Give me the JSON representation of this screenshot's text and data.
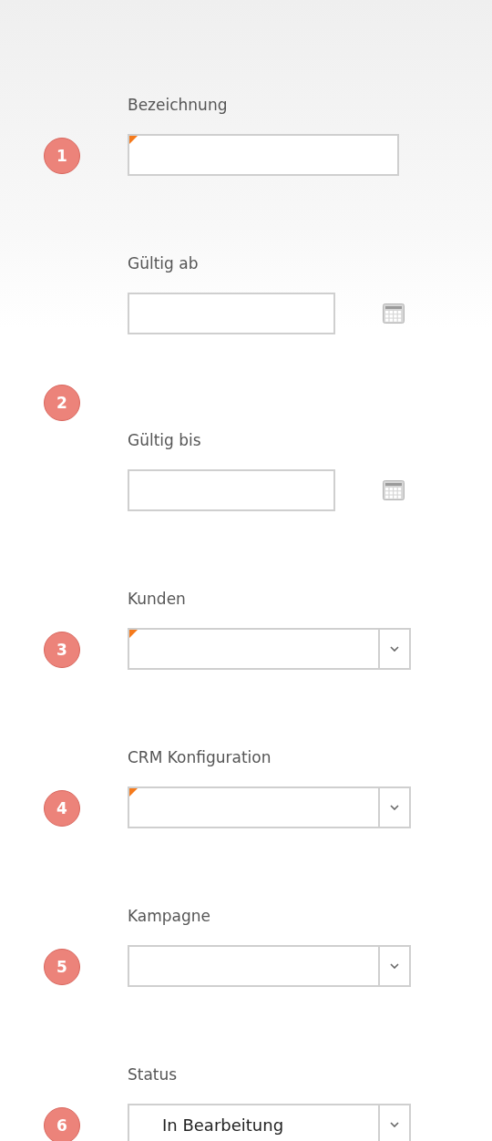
{
  "groups": [
    {
      "badge": "1",
      "fields": [
        {
          "label": "Bezeichnung",
          "kind": "text",
          "required": true
        }
      ]
    },
    {
      "badge": "2",
      "fields": [
        {
          "label": "Gültig ab",
          "kind": "date",
          "required": false
        },
        {
          "label": "Gültig bis",
          "kind": "date",
          "required": false
        }
      ]
    },
    {
      "badge": "3",
      "fields": [
        {
          "label": "Kunden",
          "kind": "combo",
          "required": true
        }
      ]
    },
    {
      "badge": "4",
      "fields": [
        {
          "label": "CRM Konfiguration",
          "kind": "combo",
          "required": true
        }
      ]
    },
    {
      "badge": "5",
      "fields": [
        {
          "label": "Kampagne",
          "kind": "combo",
          "required": false
        }
      ]
    },
    {
      "badge": "6",
      "fields": [
        {
          "label": "Status",
          "kind": "combo",
          "required": false,
          "value": "In Bearbeitung"
        }
      ]
    }
  ]
}
